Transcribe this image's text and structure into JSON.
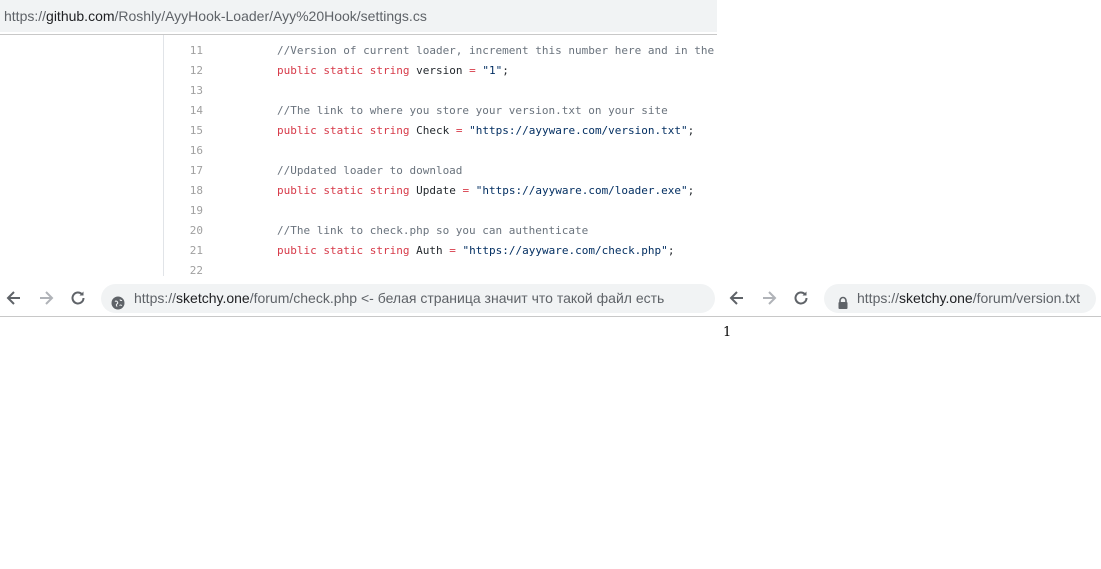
{
  "github_url": {
    "scheme": "https://",
    "host": "github.com",
    "path": "/Roshly/AyyHook-Loader/Ayy%20Hook/settings.cs"
  },
  "code_lines": [
    {
      "num": "11",
      "parts": [
        {
          "t": "        "
        },
        {
          "c": "cm",
          "t": "//Version of current loader, increment this number here and in the"
        }
      ]
    },
    {
      "num": "12",
      "parts": [
        {
          "t": "        "
        },
        {
          "c": "kw",
          "t": "public"
        },
        {
          "t": " "
        },
        {
          "c": "kw",
          "t": "static"
        },
        {
          "t": " "
        },
        {
          "c": "kw",
          "t": "string"
        },
        {
          "t": " version "
        },
        {
          "c": "kw",
          "t": "="
        },
        {
          "t": " "
        },
        {
          "c": "st",
          "t": "\"1\""
        },
        {
          "t": ";"
        }
      ]
    },
    {
      "num": "13",
      "parts": []
    },
    {
      "num": "14",
      "parts": [
        {
          "t": "        "
        },
        {
          "c": "cm",
          "t": "//The link to where you store your version.txt on your site"
        }
      ]
    },
    {
      "num": "15",
      "parts": [
        {
          "t": "        "
        },
        {
          "c": "kw",
          "t": "public"
        },
        {
          "t": " "
        },
        {
          "c": "kw",
          "t": "static"
        },
        {
          "t": " "
        },
        {
          "c": "kw",
          "t": "string"
        },
        {
          "t": " Check "
        },
        {
          "c": "kw",
          "t": "="
        },
        {
          "t": " "
        },
        {
          "c": "st",
          "t": "\"https://ayyware.com/version.txt\""
        },
        {
          "t": ";"
        }
      ]
    },
    {
      "num": "16",
      "parts": []
    },
    {
      "num": "17",
      "parts": [
        {
          "t": "        "
        },
        {
          "c": "cm",
          "t": "//Updated loader to download"
        }
      ]
    },
    {
      "num": "18",
      "parts": [
        {
          "t": "        "
        },
        {
          "c": "kw",
          "t": "public"
        },
        {
          "t": " "
        },
        {
          "c": "kw",
          "t": "static"
        },
        {
          "t": " "
        },
        {
          "c": "kw",
          "t": "string"
        },
        {
          "t": " Update "
        },
        {
          "c": "kw",
          "t": "="
        },
        {
          "t": " "
        },
        {
          "c": "st",
          "t": "\"https://ayyware.com/loader.exe\""
        },
        {
          "t": ";"
        }
      ]
    },
    {
      "num": "19",
      "parts": []
    },
    {
      "num": "20",
      "parts": [
        {
          "t": "        "
        },
        {
          "c": "cm",
          "t": "//The link to check.php so you can authenticate"
        }
      ]
    },
    {
      "num": "21",
      "parts": [
        {
          "t": "        "
        },
        {
          "c": "kw",
          "t": "public"
        },
        {
          "t": " "
        },
        {
          "c": "kw",
          "t": "static"
        },
        {
          "t": " "
        },
        {
          "c": "kw",
          "t": "string"
        },
        {
          "t": " Auth "
        },
        {
          "c": "kw",
          "t": "="
        },
        {
          "t": " "
        },
        {
          "c": "st",
          "t": "\"https://ayyware.com/check.php\""
        },
        {
          "t": ";"
        }
      ]
    },
    {
      "num": "22",
      "parts": []
    }
  ],
  "left_browser": {
    "url_scheme": "https://",
    "url_host": "sketchy.one",
    "url_path": "/forum/check.php",
    "annotation": " <- белая страница значит что такой файл есть",
    "site_icon": "info-globe-icon"
  },
  "right_browser": {
    "url_scheme": "https://",
    "url_host": "sketchy.one",
    "url_path": "/forum/version.txt",
    "site_icon": "lock-icon",
    "page_text": "1"
  },
  "colors": {
    "keyword": "#d73a49",
    "comment": "#6a737d",
    "string": "#032f62",
    "omnibox_bg": "#f1f3f4"
  }
}
